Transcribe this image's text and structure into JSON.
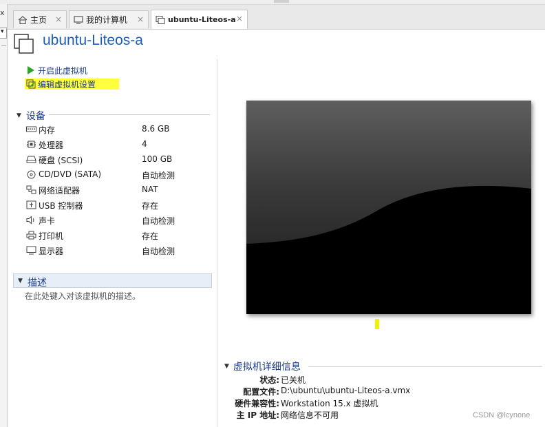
{
  "tabs": [
    {
      "label": "主页",
      "icon": "home-icon",
      "close": "×"
    },
    {
      "label": "我的计算机",
      "icon": "computer-icon",
      "close": "×"
    },
    {
      "label": "ubuntu-Liteos-a",
      "icon": "vm-icon",
      "close": "×",
      "active": true
    }
  ],
  "sliver": {
    "close": "x",
    "dropdown": "▾"
  },
  "vm": {
    "title": "ubuntu-Liteos-a"
  },
  "actions": {
    "power_on": "开启此虚拟机",
    "edit_settings": "编辑虚拟机设置",
    "highlight_color": "#ffff3d"
  },
  "devices": {
    "title": "设备",
    "items": [
      {
        "name": "内存",
        "value": "8.6 GB",
        "icon": "memory-icon"
      },
      {
        "name": "处理器",
        "value": "4",
        "icon": "processor-icon"
      },
      {
        "name": "硬盘 (SCSI)",
        "value": "100 GB",
        "icon": "hard-disk-icon"
      },
      {
        "name": "CD/DVD (SATA)",
        "value": "自动检测",
        "icon": "cd-dvd-icon"
      },
      {
        "name": "网络适配器",
        "value": "NAT",
        "icon": "network-adapter-icon"
      },
      {
        "name": "USB 控制器",
        "value": "存在",
        "icon": "usb-icon"
      },
      {
        "name": "声卡",
        "value": "自动检测",
        "icon": "sound-card-icon"
      },
      {
        "name": "打印机",
        "value": "存在",
        "icon": "printer-icon"
      },
      {
        "name": "显示器",
        "value": "自动检测",
        "icon": "display-icon"
      }
    ]
  },
  "description": {
    "title": "描述",
    "placeholder": "在此处键入对该虚拟机的描述。"
  },
  "details": {
    "title": "虚拟机详细信息",
    "rows": [
      {
        "key": "状态:",
        "value": "已关机"
      },
      {
        "key": "配置文件:",
        "value": "D:\\ubuntu\\ubuntu-Liteos-a.vmx"
      },
      {
        "key": "硬件兼容性:",
        "value": "Workstation 15.x 虚拟机"
      },
      {
        "key": "主 IP 地址:",
        "value": "网络信息不可用"
      }
    ]
  },
  "watermark": "CSDN @lcynone",
  "colors": {
    "accent": "#1a5fb4",
    "section": "#1a3b86",
    "link": "#1d3f8f",
    "play": "#2aa52a"
  }
}
